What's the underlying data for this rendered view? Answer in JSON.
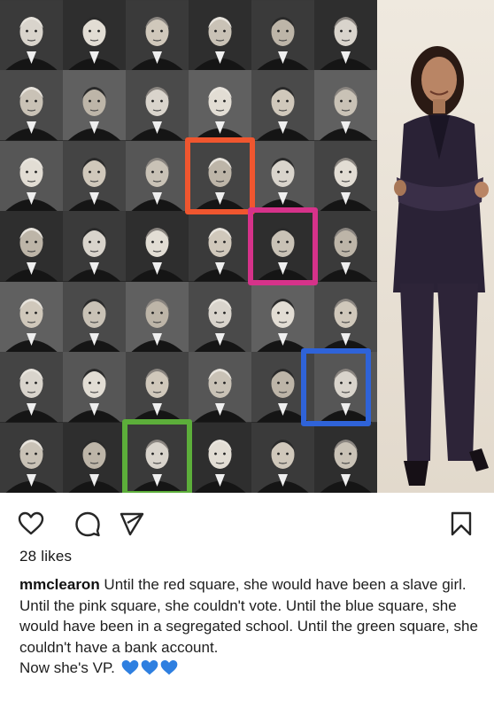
{
  "post": {
    "likes": "28 likes",
    "username": "mmclearon",
    "caption_line1": " Until the red square, she would have been a slave girl.",
    "caption_line2": "Until the pink square, she couldn't vote. Until the blue square, she would have been in a segregated school. Until the green square, she couldn't have a bank account.",
    "caption_line3": "Now she's VP.",
    "caption_emoji": [
      "blue-heart",
      "blue-heart",
      "blue-heart"
    ]
  },
  "image": {
    "grid_rows": 7,
    "grid_cols": 6,
    "highlights": [
      {
        "label": "red",
        "color": "#f0562f"
      },
      {
        "label": "pink",
        "color": "#d6328a"
      },
      {
        "label": "blue",
        "color": "#2f63d8"
      },
      {
        "label": "green",
        "color": "#5cae3a"
      }
    ]
  },
  "actions": [
    "heart-icon",
    "comment-icon",
    "share-icon",
    "bookmark-icon"
  ],
  "colors": {
    "heart_blue": "#2e7fe0",
    "icon_stroke": "#262626"
  }
}
